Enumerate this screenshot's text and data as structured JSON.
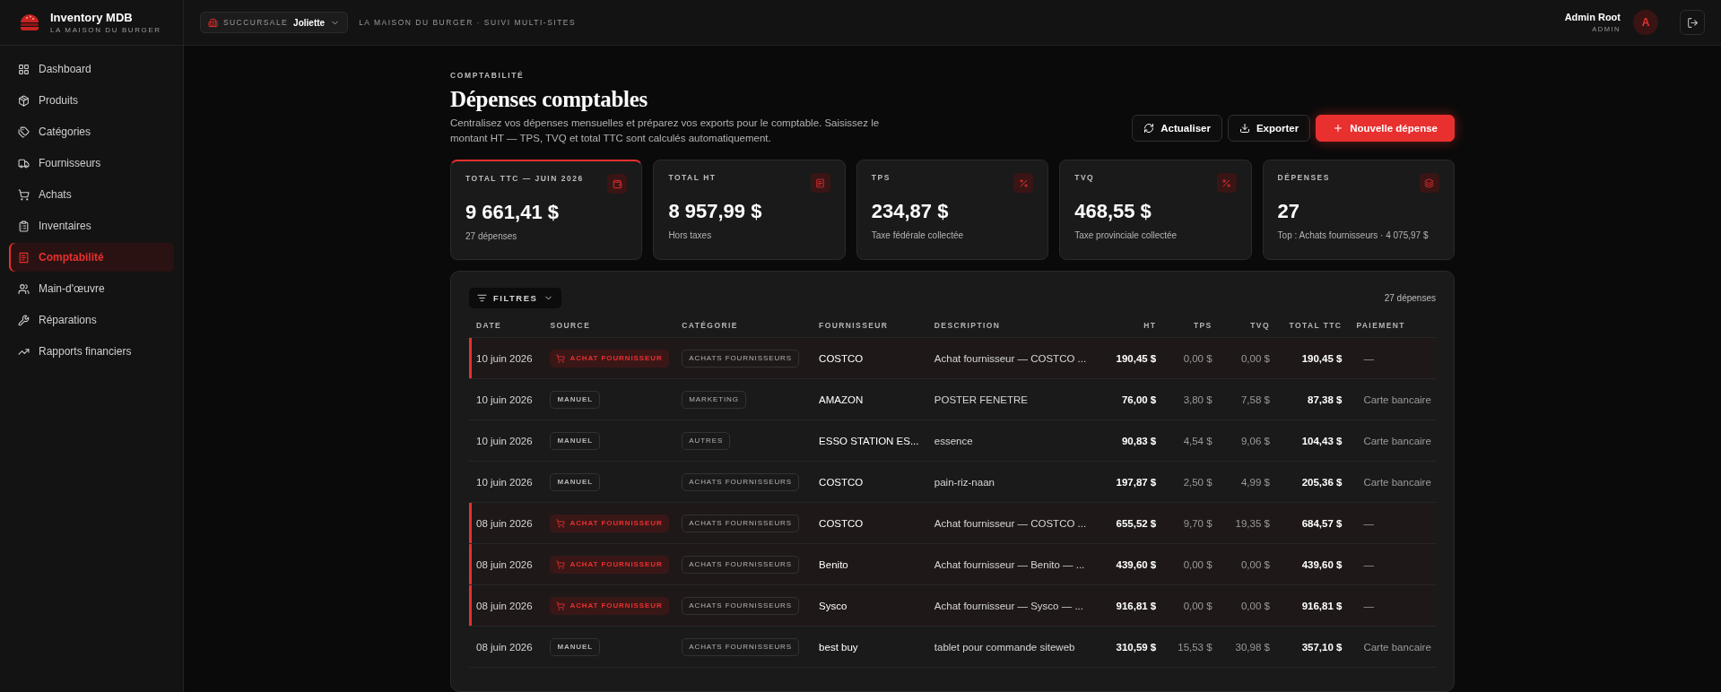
{
  "brand": {
    "name": "Inventory MDB",
    "subtitle": "LA MAISON DU BURGER"
  },
  "topbar": {
    "branch_label": "SUCCURSALE",
    "branch": "Joliette",
    "tagline": "LA MAISON DU BURGER · SUIVI MULTI-SITES",
    "user": {
      "name": "Admin Root",
      "role": "ADMIN",
      "initial": "A"
    }
  },
  "sidebar": {
    "items": [
      {
        "label": "Dashboard",
        "selected": false
      },
      {
        "label": "Produits",
        "selected": false
      },
      {
        "label": "Catégories",
        "selected": false
      },
      {
        "label": "Fournisseurs",
        "selected": false
      },
      {
        "label": "Achats",
        "selected": false
      },
      {
        "label": "Inventaires",
        "selected": false
      },
      {
        "label": "Comptabilité",
        "selected": true
      },
      {
        "label": "Main-d'œuvre",
        "selected": false
      },
      {
        "label": "Réparations",
        "selected": false
      },
      {
        "label": "Rapports financiers",
        "selected": false
      }
    ]
  },
  "header": {
    "eyebrow": "COMPTABILITÉ",
    "title": "Dépenses comptables",
    "description": "Centralisez vos dépenses mensuelles et préparez vos exports pour le comptable. Saisissez le montant HT — TPS, TVQ et total TTC sont calculés automatiquement.",
    "buttons": [
      {
        "label": "Actualiser",
        "kind": "secondary"
      },
      {
        "label": "Exporter",
        "kind": "secondary"
      },
      {
        "label": "Nouvelle dépense",
        "kind": "primary"
      }
    ]
  },
  "stats": [
    {
      "label": "TOTAL TTC — JUIN 2026",
      "value": "9 661,41 $",
      "note": "27 dépenses",
      "highlighted": true
    },
    {
      "label": "TOTAL HT",
      "value": "8 957,99 $",
      "note": "Hors taxes",
      "highlighted": false
    },
    {
      "label": "TPS",
      "value": "234,87 $",
      "note": "Taxe fédérale collectée",
      "highlighted": false
    },
    {
      "label": "TVQ",
      "value": "468,55 $",
      "note": "Taxe provinciale collectée",
      "highlighted": false
    },
    {
      "label": "DÉPENSES",
      "value": "27",
      "note": "Top : Achats fournisseurs · 4 075,97 $",
      "highlighted": false
    }
  ],
  "table": {
    "filter_label": "FILTRES",
    "count": "27 dépenses",
    "columns": [
      "DATE",
      "SOURCE",
      "CATÉGORIE",
      "FOURNISSEUR",
      "DESCRIPTION",
      "HT",
      "TPS",
      "TVQ",
      "TOTAL TTC",
      "PAIEMENT"
    ],
    "rows": [
      {
        "date": "10 juin 2026",
        "source": {
          "label": "ACHAT FOURNISSEUR",
          "kind": "purchase"
        },
        "category": "ACHATS FOURNISSEURS",
        "supplier": "COSTCO",
        "description": "Achat fournisseur — COSTCO ...",
        "ht": "190,45 $",
        "tps": "0,00 $",
        "tvq": "0,00 $",
        "ttc": "190,45 $",
        "payment": "—"
      },
      {
        "date": "10 juin 2026",
        "source": {
          "label": "MANUEL",
          "kind": "manual"
        },
        "category": "MARKETING",
        "supplier": "AMAZON",
        "description": "POSTER FENETRE",
        "ht": "76,00 $",
        "tps": "3,80 $",
        "tvq": "7,58 $",
        "ttc": "87,38 $",
        "payment": "Carte bancaire"
      },
      {
        "date": "10 juin 2026",
        "source": {
          "label": "MANUEL",
          "kind": "manual"
        },
        "category": "AUTRES",
        "supplier": "ESSO STATION ES...",
        "description": "essence",
        "ht": "90,83 $",
        "tps": "4,54 $",
        "tvq": "9,06 $",
        "ttc": "104,43 $",
        "payment": "Carte bancaire"
      },
      {
        "date": "10 juin 2026",
        "source": {
          "label": "MANUEL",
          "kind": "manual"
        },
        "category": "ACHATS FOURNISSEURS",
        "supplier": "COSTCO",
        "description": "pain-riz-naan",
        "ht": "197,87 $",
        "tps": "2,50 $",
        "tvq": "4,99 $",
        "ttc": "205,36 $",
        "payment": "Carte bancaire"
      },
      {
        "date": "08 juin 2026",
        "source": {
          "label": "ACHAT FOURNISSEUR",
          "kind": "purchase"
        },
        "category": "ACHATS FOURNISSEURS",
        "supplier": "COSTCO",
        "description": "Achat fournisseur — COSTCO ...",
        "ht": "655,52 $",
        "tps": "9,70 $",
        "tvq": "19,35 $",
        "ttc": "684,57 $",
        "payment": "—"
      },
      {
        "date": "08 juin 2026",
        "source": {
          "label": "ACHAT FOURNISSEUR",
          "kind": "purchase"
        },
        "category": "ACHATS FOURNISSEURS",
        "supplier": "Benito",
        "description": "Achat fournisseur — Benito — ...",
        "ht": "439,60 $",
        "tps": "0,00 $",
        "tvq": "0,00 $",
        "ttc": "439,60 $",
        "payment": "—"
      },
      {
        "date": "08 juin 2026",
        "source": {
          "label": "ACHAT FOURNISSEUR",
          "kind": "purchase"
        },
        "category": "ACHATS FOURNISSEURS",
        "supplier": "Sysco",
        "description": "Achat fournisseur — Sysco — ...",
        "ht": "916,81 $",
        "tps": "0,00 $",
        "tvq": "0,00 $",
        "ttc": "916,81 $",
        "payment": "—"
      },
      {
        "date": "08 juin 2026",
        "source": {
          "label": "MANUEL",
          "kind": "manual"
        },
        "category": "ACHATS FOURNISSEURS",
        "supplier": "best buy",
        "description": "tablet pour commande siteweb",
        "ht": "310,59 $",
        "tps": "15,53 $",
        "tvq": "30,98 $",
        "ttc": "357,10 $",
        "payment": "Carte bancaire"
      }
    ]
  }
}
